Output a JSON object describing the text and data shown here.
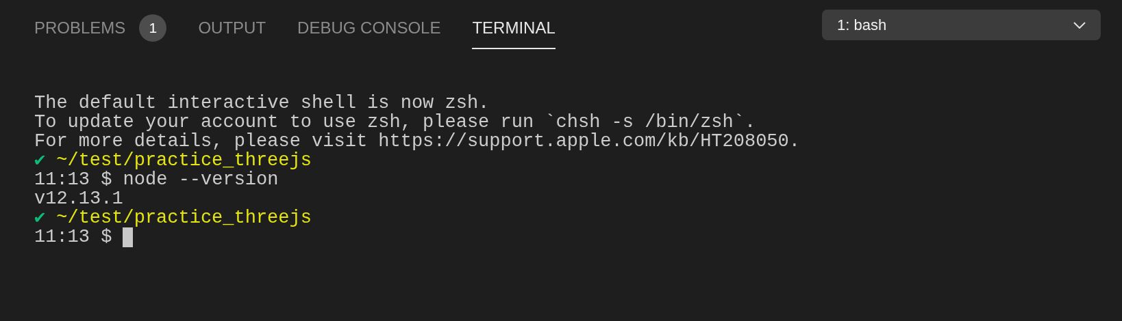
{
  "tabs": [
    {
      "label": "PROBLEMS",
      "badge": "1",
      "selected": false
    },
    {
      "label": "OUTPUT",
      "selected": false
    },
    {
      "label": "DEBUG CONSOLE",
      "selected": false
    },
    {
      "label": "TERMINAL",
      "selected": true
    }
  ],
  "terminal_select": {
    "value": "1: bash"
  },
  "terminal_lines": [
    {
      "kind": "output",
      "text": "The default interactive shell is now zsh.",
      "cursor": false
    },
    {
      "kind": "output",
      "text": "To update your account to use zsh, please run `chsh -s /bin/zsh`.",
      "cursor": false
    },
    {
      "kind": "output",
      "text": "For more details, please visit https://support.apple.com/kb/HT208050.",
      "cursor": false
    },
    {
      "kind": "path",
      "mark": "✔",
      "text": "~/test/practice_threejs",
      "cursor": false
    },
    {
      "kind": "output",
      "text": "11:13 $ node --version",
      "cursor": false
    },
    {
      "kind": "output",
      "text": "v12.13.1",
      "cursor": false
    },
    {
      "kind": "path",
      "mark": "✔",
      "text": "~/test/practice_threejs",
      "cursor": false
    },
    {
      "kind": "output",
      "text": "11:13 $",
      "cursor": true
    }
  ]
}
